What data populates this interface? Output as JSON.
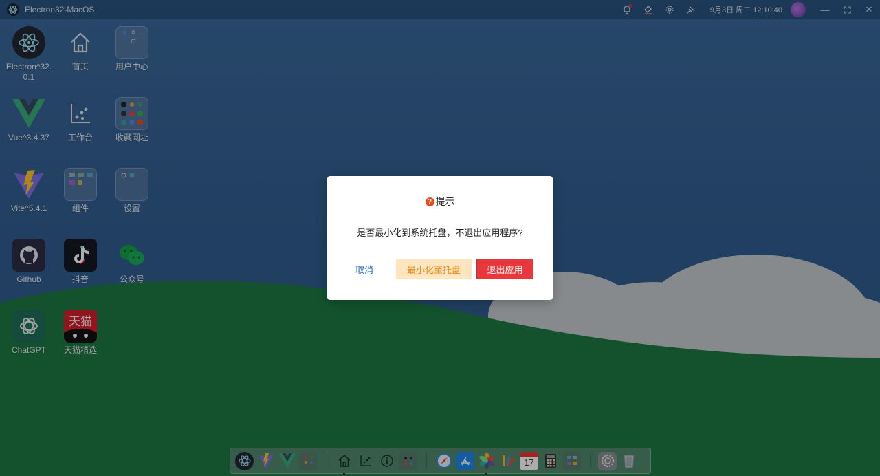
{
  "app": {
    "title": "Electron32-MacOS"
  },
  "topbar": {
    "clock": "9月3日 周二 12:10:40"
  },
  "desktop": {
    "icons": [
      {
        "label": "Electron^32.0.1"
      },
      {
        "label": "首页"
      },
      {
        "label": "用户中心"
      },
      {
        "label": "Vue^3.4.37"
      },
      {
        "label": "工作台"
      },
      {
        "label": "收藏网址"
      },
      {
        "label": "Vite^5.4.1"
      },
      {
        "label": "组件"
      },
      {
        "label": "设置"
      },
      {
        "label": "Github"
      },
      {
        "label": "抖音"
      },
      {
        "label": "公众号"
      },
      {
        "label": "ChatGPT"
      },
      {
        "label": "天猫精选"
      }
    ]
  },
  "dialog": {
    "title": "提示",
    "message": "是否最小化到系统托盘，不退出应用程序?",
    "cancel_label": "取消",
    "minimize_label": "最小化至托盘",
    "quit_label": "退出应用"
  },
  "dock": {
    "calendar_day": "17"
  },
  "colors": {
    "quit_button": "#e8383d",
    "minimize_button_bg": "#fde5bf",
    "cancel_text": "#1f5fbf",
    "hill_green": "#1e7a45"
  }
}
